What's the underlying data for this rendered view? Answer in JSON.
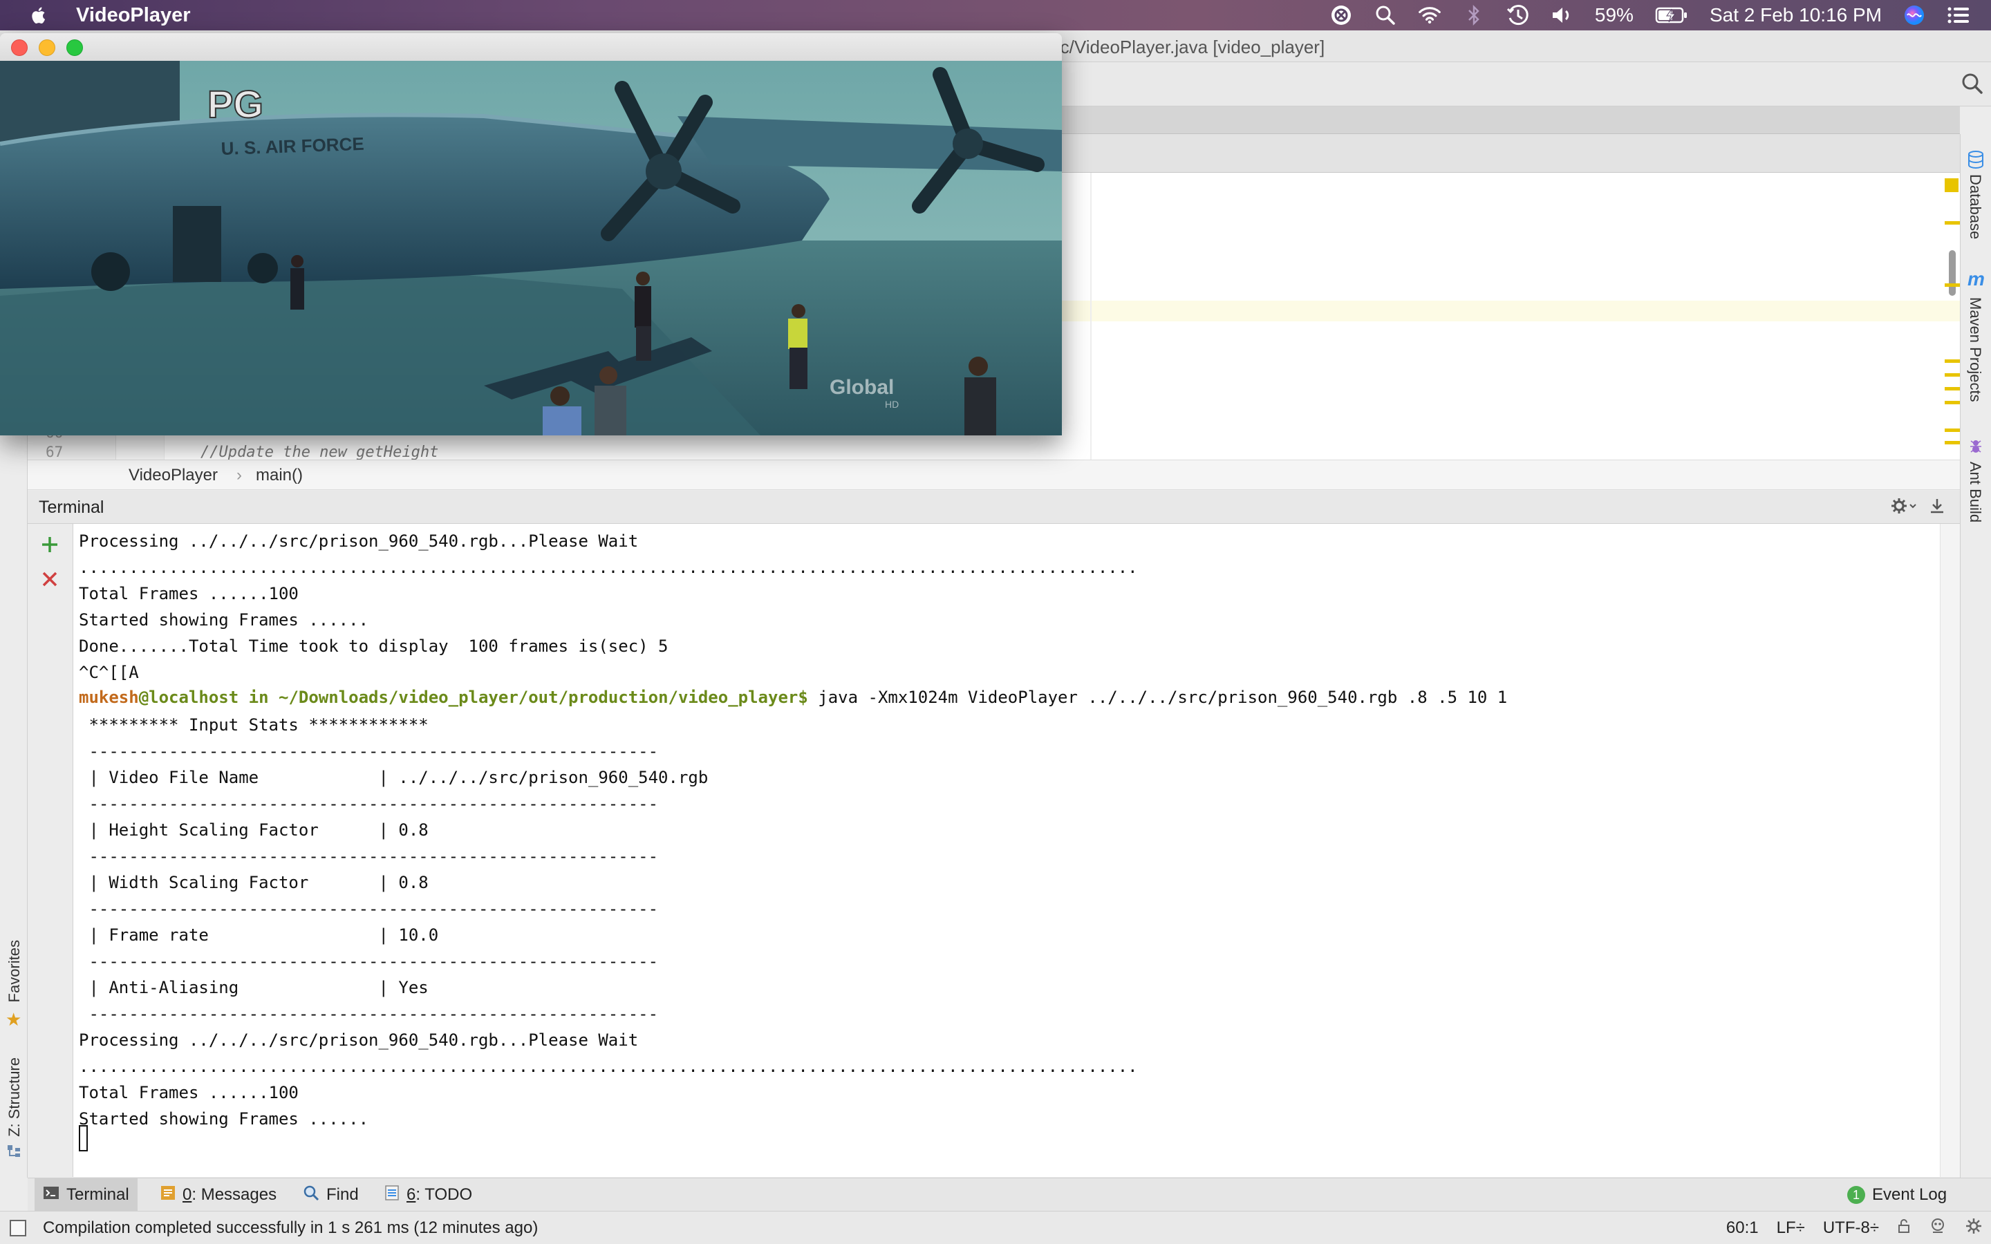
{
  "menubar": {
    "app_name": "VideoPlayer",
    "battery": "59%",
    "datetime": "Sat 2 Feb  10:16 PM"
  },
  "ide": {
    "window_title": "rc/VideoPlayer.java [video_player]",
    "line_numbers": [
      "66",
      "67"
    ],
    "code_line": "//Update the new getHeight",
    "breadcrumb": [
      "VideoPlayer",
      "main()"
    ],
    "right_tools": [
      "Database",
      "Maven Projects",
      "Ant Build"
    ],
    "left_tools": [
      "Favorites",
      "Z: Structure"
    ]
  },
  "video_window": {
    "watermark_rating": "PG",
    "aircraft_text": "U. S. AIR FORCE",
    "channel_logo": "Global",
    "channel_logo_sub": "HD"
  },
  "terminal": {
    "title": "Terminal",
    "prompt_user": "mukesh",
    "prompt_host": "@localhost in ~/Downloads/video_player/out/production/video_player$",
    "command": " java -Xmx1024m VideoPlayer ../../../src/prison_960_540.rgb .8 .5 10 1",
    "lines": [
      "Processing ../../../src/prison_960_540.rgb...Please Wait",
      "..........................................................................................................",
      "Total Frames ......100",
      "Started showing Frames ......",
      "Done.......Total Time took to display  100 frames is(sec) 5",
      "^C^[[A",
      "",
      " ********* Input Stats ************",
      " ---------------------------------------------------------",
      " | Video File Name            | ../../../src/prison_960_540.rgb",
      " ---------------------------------------------------------",
      " | Height Scaling Factor      | 0.8",
      " ---------------------------------------------------------",
      " | Width Scaling Factor       | 0.8",
      " ---------------------------------------------------------",
      " | Frame rate                 | 10.0",
      " ---------------------------------------------------------",
      " | Anti-Aliasing              | Yes",
      " ---------------------------------------------------------",
      "Processing ../../../src/prison_960_540.rgb...Please Wait",
      "..........................................................................................................",
      "Total Frames ......100",
      "Started showing Frames ......"
    ]
  },
  "bottom_tabs": {
    "terminal": "Terminal",
    "messages_num": "0",
    "messages": ": Messages",
    "find": "Find",
    "todo_num": "6",
    "todo": ": TODO",
    "event_log_count": "1",
    "event_log": "Event Log"
  },
  "statusbar": {
    "message": "Compilation completed successfully in 1 s 261 ms (12 minutes ago)",
    "position": "60:1",
    "line_sep": "LF÷",
    "encoding": "UTF-8÷"
  },
  "colors": {
    "prompt_user": "#c26a1c",
    "prompt_host": "#6b8a1a",
    "marker": "#e8c400",
    "add_green": "#3a9a3a",
    "close_red": "#d04040"
  }
}
